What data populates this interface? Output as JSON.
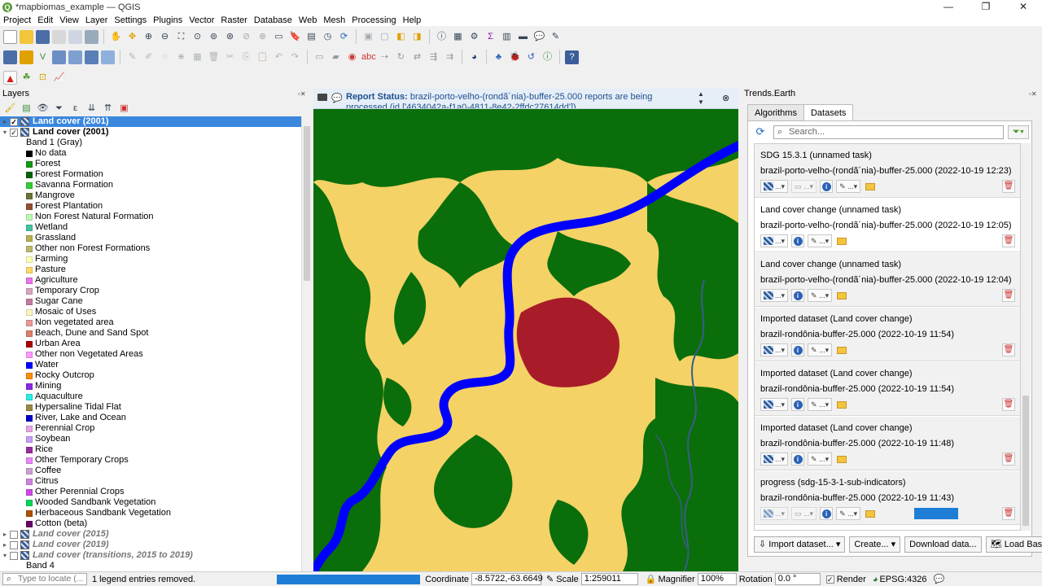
{
  "window": {
    "title": "*mapbiomas_example — QGIS",
    "controls": [
      "—",
      "❐",
      "✕"
    ]
  },
  "menu": [
    "Project",
    "Edit",
    "View",
    "Layer",
    "Settings",
    "Plugins",
    "Vector",
    "Raster",
    "Database",
    "Web",
    "Mesh",
    "Processing",
    "Help"
  ],
  "layers_panel": {
    "title": "Layers",
    "items": [
      {
        "kind": "layer",
        "label": "Land cover (2001)",
        "selected": true,
        "checked": true,
        "expanded": false,
        "style": "bold"
      },
      {
        "kind": "layer",
        "label": "Land cover (2001)",
        "selected": false,
        "checked": true,
        "expanded": true,
        "style": "bold"
      },
      {
        "kind": "band",
        "label": "Band 1 (Gray)"
      },
      {
        "kind": "legend",
        "label": "No data",
        "color": "#000000"
      },
      {
        "kind": "legend",
        "label": "Forest",
        "color": "#129912"
      },
      {
        "kind": "legend",
        "label": "Forest Formation",
        "color": "#006400"
      },
      {
        "kind": "legend",
        "label": "Savanna Formation",
        "color": "#32cd32"
      },
      {
        "kind": "legend",
        "label": "Mangrove",
        "color": "#687537"
      },
      {
        "kind": "legend",
        "label": "Forest Plantation",
        "color": "#935132"
      },
      {
        "kind": "legend",
        "label": "Non Forest Natural Formation",
        "color": "#bbfcac"
      },
      {
        "kind": "legend",
        "label": "Wetland",
        "color": "#45c2a5"
      },
      {
        "kind": "legend",
        "label": "Grassland",
        "color": "#b8af4f"
      },
      {
        "kind": "legend",
        "label": "Other non Forest Formations",
        "color": "#bdb76b"
      },
      {
        "kind": "legend",
        "label": "Farming",
        "color": "#ffffb2"
      },
      {
        "kind": "legend",
        "label": "Pasture",
        "color": "#ffd966"
      },
      {
        "kind": "legend",
        "label": "Agriculture",
        "color": "#e974ed"
      },
      {
        "kind": "legend",
        "label": "Temporary Crop",
        "color": "#d5a6bd"
      },
      {
        "kind": "legend",
        "label": "Sugar Cane",
        "color": "#c27ba0"
      },
      {
        "kind": "legend",
        "label": "Mosaic of Uses",
        "color": "#fff3bf"
      },
      {
        "kind": "legend",
        "label": "Non vegetated area",
        "color": "#ea9999"
      },
      {
        "kind": "legend",
        "label": "Beach, Dune and Sand Spot",
        "color": "#dd7e6b"
      },
      {
        "kind": "legend",
        "label": "Urban Area",
        "color": "#aa0000"
      },
      {
        "kind": "legend",
        "label": "Other non Vegetated Areas",
        "color": "#ff99ff"
      },
      {
        "kind": "legend",
        "label": "Water",
        "color": "#0000ff"
      },
      {
        "kind": "legend",
        "label": "Rocky Outcrop",
        "color": "#ff8c00"
      },
      {
        "kind": "legend",
        "label": "Mining",
        "color": "#8a2be2"
      },
      {
        "kind": "legend",
        "label": "Aquaculture",
        "color": "#29eee4"
      },
      {
        "kind": "legend",
        "label": "Hypersaline Tidal Flat",
        "color": "#968c46"
      },
      {
        "kind": "legend",
        "label": "River, Lake and Ocean",
        "color": "#0000cd"
      },
      {
        "kind": "legend",
        "label": "Perennial Crop",
        "color": "#e6a6e6"
      },
      {
        "kind": "legend",
        "label": "Soybean",
        "color": "#c59ff4"
      },
      {
        "kind": "legend",
        "label": "Rice",
        "color": "#982c9e"
      },
      {
        "kind": "legend",
        "label": "Other Temporary Crops",
        "color": "#e787f8"
      },
      {
        "kind": "legend",
        "label": "Coffee",
        "color": "#cca0d4"
      },
      {
        "kind": "legend",
        "label": "Citrus",
        "color": "#d082de"
      },
      {
        "kind": "legend",
        "label": "Other Perennial Crops",
        "color": "#cd49e4"
      },
      {
        "kind": "legend",
        "label": "Wooded Sandbank Vegetation",
        "color": "#02d659"
      },
      {
        "kind": "legend",
        "label": "Herbaceous Sandbank Vegetation",
        "color": "#ad5100"
      },
      {
        "kind": "legend",
        "label": "Cotton (beta)",
        "color": "#660066"
      },
      {
        "kind": "layer",
        "label": "Land cover (2015)",
        "selected": false,
        "checked": false,
        "expanded": false,
        "style": "italic"
      },
      {
        "kind": "layer",
        "label": "Land cover (2019)",
        "selected": false,
        "checked": false,
        "expanded": false,
        "style": "italic"
      },
      {
        "kind": "layer",
        "label": "Land cover (transitions, 2015 to 2019)",
        "selected": false,
        "checked": false,
        "expanded": true,
        "style": "italic"
      },
      {
        "kind": "band",
        "label": "Band 4"
      }
    ]
  },
  "message_bar": {
    "label": "Report Status:",
    "text": "brazil-porto-velho-(rondã´nia)-buffer-25.000 reports are being processed (id ['4634042a-f1a0-4811-8e42-2ffdc27614dd'])"
  },
  "trends_earth": {
    "title": "Trends.Earth",
    "tabs": [
      {
        "label": "Algorithms",
        "active": false
      },
      {
        "label": "Datasets",
        "active": true
      }
    ],
    "search_placeholder": "Search...",
    "datasets": [
      {
        "title": "SDG 15.3.1 (unnamed task)",
        "subtitle": "brazil-porto-velho-(rondã´nia)-buffer-25.000 (2022-10-19 12:23)",
        "variant": "sdg",
        "bg": "gray"
      },
      {
        "title": "Land cover change (unnamed task)",
        "subtitle": "brazil-porto-velho-(rondã´nia)-buffer-25.000 (2022-10-19 12:05)",
        "variant": "std",
        "bg": "white"
      },
      {
        "title": "Land cover change (unnamed task)",
        "subtitle": "brazil-porto-velho-(rondã´nia)-buffer-25.000 (2022-10-19 12:04)",
        "variant": "std",
        "bg": "gray"
      },
      {
        "title": "Imported dataset (Land cover change)",
        "subtitle": "brazil-rondônia-buffer-25.000 (2022-10-19 11:54)",
        "variant": "std",
        "bg": "gray"
      },
      {
        "title": "Imported dataset (Land cover change)",
        "subtitle": "brazil-rondônia-buffer-25.000 (2022-10-19 11:54)",
        "variant": "std",
        "bg": "gray"
      },
      {
        "title": "Imported dataset (Land cover change)",
        "subtitle": "brazil-rondônia-buffer-25.000 (2022-10-19 11:48)",
        "variant": "std",
        "bg": "gray"
      },
      {
        "title": "progress (sdg-15-3-1-sub-indicators)",
        "subtitle": "brazil-rondônia-buffer-25.000 (2022-10-19 11:43)",
        "variant": "progress",
        "bg": "gray",
        "progress": 1.0
      }
    ],
    "buttons": {
      "import": "Import dataset...",
      "create": "Create...",
      "download": "Download data...",
      "basemap": "Load Base Map"
    }
  },
  "status": {
    "locate_placeholder": "Type to locate (...",
    "message": "1 legend entries removed.",
    "coordinate_label": "Coordinate",
    "coordinate": "-8.5722,-63.6649",
    "scale_label": "Scale",
    "scale": "1:259011",
    "magnifier_label": "Magnifier",
    "magnifier": "100%",
    "rotation_label": "Rotation",
    "rotation": "0.0 °",
    "render_label": "Render",
    "crs": "EPSG:4326"
  },
  "colors": {
    "forest": "#006400",
    "pasture": "#f4d266",
    "water": "#0000ff",
    "urban": "#aa1e2b",
    "accent": "#3a87de"
  }
}
